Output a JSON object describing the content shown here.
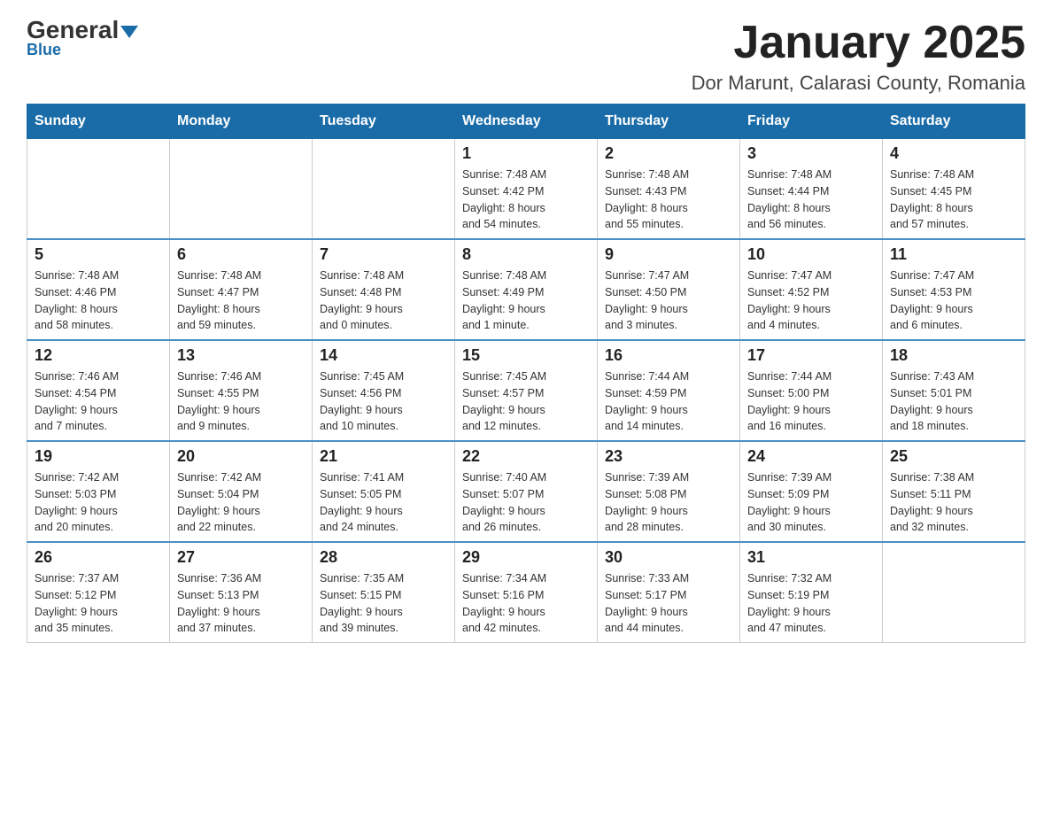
{
  "header": {
    "logo_main": "General",
    "logo_sub": "Blue",
    "title": "January 2025",
    "subtitle": "Dor Marunt, Calarasi County, Romania"
  },
  "days_of_week": [
    "Sunday",
    "Monday",
    "Tuesday",
    "Wednesday",
    "Thursday",
    "Friday",
    "Saturday"
  ],
  "weeks": [
    [
      {
        "day": "",
        "info": ""
      },
      {
        "day": "",
        "info": ""
      },
      {
        "day": "",
        "info": ""
      },
      {
        "day": "1",
        "info": "Sunrise: 7:48 AM\nSunset: 4:42 PM\nDaylight: 8 hours\nand 54 minutes."
      },
      {
        "day": "2",
        "info": "Sunrise: 7:48 AM\nSunset: 4:43 PM\nDaylight: 8 hours\nand 55 minutes."
      },
      {
        "day": "3",
        "info": "Sunrise: 7:48 AM\nSunset: 4:44 PM\nDaylight: 8 hours\nand 56 minutes."
      },
      {
        "day": "4",
        "info": "Sunrise: 7:48 AM\nSunset: 4:45 PM\nDaylight: 8 hours\nand 57 minutes."
      }
    ],
    [
      {
        "day": "5",
        "info": "Sunrise: 7:48 AM\nSunset: 4:46 PM\nDaylight: 8 hours\nand 58 minutes."
      },
      {
        "day": "6",
        "info": "Sunrise: 7:48 AM\nSunset: 4:47 PM\nDaylight: 8 hours\nand 59 minutes."
      },
      {
        "day": "7",
        "info": "Sunrise: 7:48 AM\nSunset: 4:48 PM\nDaylight: 9 hours\nand 0 minutes."
      },
      {
        "day": "8",
        "info": "Sunrise: 7:48 AM\nSunset: 4:49 PM\nDaylight: 9 hours\nand 1 minute."
      },
      {
        "day": "9",
        "info": "Sunrise: 7:47 AM\nSunset: 4:50 PM\nDaylight: 9 hours\nand 3 minutes."
      },
      {
        "day": "10",
        "info": "Sunrise: 7:47 AM\nSunset: 4:52 PM\nDaylight: 9 hours\nand 4 minutes."
      },
      {
        "day": "11",
        "info": "Sunrise: 7:47 AM\nSunset: 4:53 PM\nDaylight: 9 hours\nand 6 minutes."
      }
    ],
    [
      {
        "day": "12",
        "info": "Sunrise: 7:46 AM\nSunset: 4:54 PM\nDaylight: 9 hours\nand 7 minutes."
      },
      {
        "day": "13",
        "info": "Sunrise: 7:46 AM\nSunset: 4:55 PM\nDaylight: 9 hours\nand 9 minutes."
      },
      {
        "day": "14",
        "info": "Sunrise: 7:45 AM\nSunset: 4:56 PM\nDaylight: 9 hours\nand 10 minutes."
      },
      {
        "day": "15",
        "info": "Sunrise: 7:45 AM\nSunset: 4:57 PM\nDaylight: 9 hours\nand 12 minutes."
      },
      {
        "day": "16",
        "info": "Sunrise: 7:44 AM\nSunset: 4:59 PM\nDaylight: 9 hours\nand 14 minutes."
      },
      {
        "day": "17",
        "info": "Sunrise: 7:44 AM\nSunset: 5:00 PM\nDaylight: 9 hours\nand 16 minutes."
      },
      {
        "day": "18",
        "info": "Sunrise: 7:43 AM\nSunset: 5:01 PM\nDaylight: 9 hours\nand 18 minutes."
      }
    ],
    [
      {
        "day": "19",
        "info": "Sunrise: 7:42 AM\nSunset: 5:03 PM\nDaylight: 9 hours\nand 20 minutes."
      },
      {
        "day": "20",
        "info": "Sunrise: 7:42 AM\nSunset: 5:04 PM\nDaylight: 9 hours\nand 22 minutes."
      },
      {
        "day": "21",
        "info": "Sunrise: 7:41 AM\nSunset: 5:05 PM\nDaylight: 9 hours\nand 24 minutes."
      },
      {
        "day": "22",
        "info": "Sunrise: 7:40 AM\nSunset: 5:07 PM\nDaylight: 9 hours\nand 26 minutes."
      },
      {
        "day": "23",
        "info": "Sunrise: 7:39 AM\nSunset: 5:08 PM\nDaylight: 9 hours\nand 28 minutes."
      },
      {
        "day": "24",
        "info": "Sunrise: 7:39 AM\nSunset: 5:09 PM\nDaylight: 9 hours\nand 30 minutes."
      },
      {
        "day": "25",
        "info": "Sunrise: 7:38 AM\nSunset: 5:11 PM\nDaylight: 9 hours\nand 32 minutes."
      }
    ],
    [
      {
        "day": "26",
        "info": "Sunrise: 7:37 AM\nSunset: 5:12 PM\nDaylight: 9 hours\nand 35 minutes."
      },
      {
        "day": "27",
        "info": "Sunrise: 7:36 AM\nSunset: 5:13 PM\nDaylight: 9 hours\nand 37 minutes."
      },
      {
        "day": "28",
        "info": "Sunrise: 7:35 AM\nSunset: 5:15 PM\nDaylight: 9 hours\nand 39 minutes."
      },
      {
        "day": "29",
        "info": "Sunrise: 7:34 AM\nSunset: 5:16 PM\nDaylight: 9 hours\nand 42 minutes."
      },
      {
        "day": "30",
        "info": "Sunrise: 7:33 AM\nSunset: 5:17 PM\nDaylight: 9 hours\nand 44 minutes."
      },
      {
        "day": "31",
        "info": "Sunrise: 7:32 AM\nSunset: 5:19 PM\nDaylight: 9 hours\nand 47 minutes."
      },
      {
        "day": "",
        "info": ""
      }
    ]
  ]
}
